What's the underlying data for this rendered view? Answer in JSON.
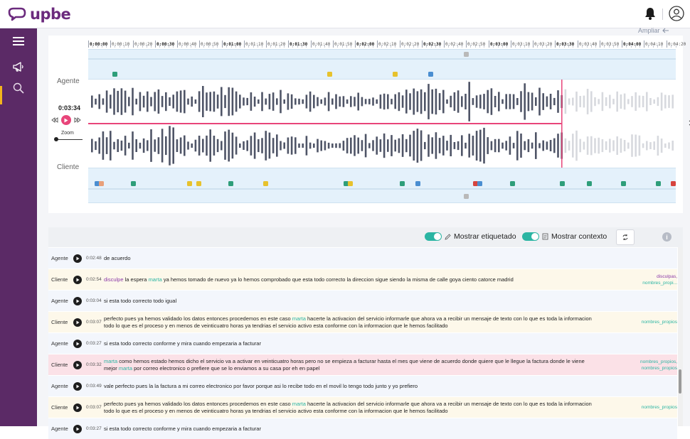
{
  "app": {
    "brand": "upbe"
  },
  "header": {
    "bell_icon": "bell-icon",
    "user_icon": "user-circle-icon"
  },
  "sidebar": {
    "items": [
      {
        "icon": "hamburger-menu-icon"
      },
      {
        "icon": "megaphone-icon",
        "active": true
      },
      {
        "icon": "search-icon"
      }
    ]
  },
  "waveform": {
    "ampliar": "Ampliar",
    "agent_label": "Agente",
    "client_label": "Cliente",
    "current_time": "0:03:34",
    "zoom_label": "Zoom",
    "playhead_fraction": 0.806,
    "ruler": [
      "0:00:00",
      "0:00:10",
      "0:00:20",
      "0:00:30",
      "0:00:40",
      "0:00:50",
      "0:01:00",
      "0:01:10",
      "0:01:20",
      "0:01:30",
      "0:01:40",
      "0:01:50",
      "0:02:00",
      "0:02:10",
      "0:02:20",
      "0:02:30",
      "0:02:40",
      "0:02:50",
      "0:03:00",
      "0:03:10",
      "0:03:20",
      "0:03:30",
      "0:03:40",
      "0:03:50",
      "0:04:00",
      "0:04:10",
      "0:04:20"
    ],
    "ruler_bold": [
      "0:00:00",
      "0:00:30",
      "0:01:00",
      "0:01:30",
      "0:02:00",
      "0:02:30",
      "0:03:00",
      "0:03:30",
      "0:04:00"
    ],
    "agent_top_markers": [
      {
        "pos": 0.643,
        "color": "#b9b9b9"
      }
    ],
    "agent_markers": [
      {
        "pos": 0.045,
        "color": "#2e9e7a"
      },
      {
        "pos": 0.41,
        "color": "#e7c22d"
      },
      {
        "pos": 0.522,
        "color": "#e7c22d"
      },
      {
        "pos": 0.582,
        "color": "#4a8ed1"
      }
    ],
    "client_markers": [
      {
        "pos": 0.015,
        "color": "#4a8ed1"
      },
      {
        "pos": 0.022,
        "color": "#e8a07a"
      },
      {
        "pos": 0.076,
        "color": "#2e9e7a"
      },
      {
        "pos": 0.172,
        "color": "#e7c22d"
      },
      {
        "pos": 0.188,
        "color": "#e7c22d"
      },
      {
        "pos": 0.242,
        "color": "#2e9e7a"
      },
      {
        "pos": 0.302,
        "color": "#e7c22d"
      },
      {
        "pos": 0.438,
        "color": "#2e9e7a"
      },
      {
        "pos": 0.446,
        "color": "#e7c22d"
      },
      {
        "pos": 0.534,
        "color": "#2e9e7a"
      },
      {
        "pos": 0.56,
        "color": "#4a8ed1"
      },
      {
        "pos": 0.658,
        "color": "#d6443e"
      },
      {
        "pos": 0.666,
        "color": "#4a8ed1"
      },
      {
        "pos": 0.722,
        "color": "#2e9e7a"
      },
      {
        "pos": 0.806,
        "color": "#2e9e7a"
      },
      {
        "pos": 0.852,
        "color": "#2e9e7a"
      },
      {
        "pos": 0.91,
        "color": "#2e9e7a"
      },
      {
        "pos": 0.97,
        "color": "#2e9e7a"
      },
      {
        "pos": 0.995,
        "color": "#d6443e"
      }
    ],
    "client_bottom_markers": [
      {
        "pos": 0.643,
        "color": "#b9b9b9"
      }
    ]
  },
  "transcript": {
    "toggle_tags": "Mostrar etiquetado",
    "toggle_context": "Mostrar contexto",
    "sync_icon": "sync-icon",
    "info": "i",
    "rows": [
      {
        "speaker": "Agente",
        "time": "0:02:48",
        "bg": "#f3f6fc",
        "segments": [
          {
            "t": "de acuerdo",
            "c": ""
          }
        ],
        "tags": []
      },
      {
        "speaker": "Cliente",
        "time": "0:02:54",
        "bg": "#fdf8ea",
        "segments": [
          {
            "t": "disculpe",
            "c": "hp"
          },
          {
            "t": " la espera ",
            "c": ""
          },
          {
            "t": "marta",
            "c": "hl"
          },
          {
            "t": " ya hemos tomado de nuevo ya lo hemos comprobado que esta todo correcto la direccion sigue siendo la misma de calle goya ciento catorce madrid",
            "c": ""
          }
        ],
        "tags": [
          {
            "t": "disculpas,",
            "c": "tgp"
          },
          {
            "t": "nombres_propi...",
            "c": "tgg"
          }
        ]
      },
      {
        "speaker": "Agente",
        "time": "0:03:04",
        "bg": "#f3f6fc",
        "segments": [
          {
            "t": "si esta todo correcto todo igual",
            "c": ""
          }
        ],
        "tags": []
      },
      {
        "speaker": "Cliente",
        "time": "0:03:07",
        "bg": "#fdf8ea",
        "segments": [
          {
            "t": "perfecto pues ya hemos validado los datos entonces procedemos en este caso ",
            "c": ""
          },
          {
            "t": "marta",
            "c": "hl"
          },
          {
            "t": " hacerte la activacion del servicio informarle que ahora va a recibir un mensaje de texto con lo que es toda la informacion todo lo que es el proceso y en menos de veinticuatro horas ya tendrias el servicio activo esta conforme con la informacion que le hemos facilitado",
            "c": ""
          }
        ],
        "tags": [
          {
            "t": "nombres_propios",
            "c": "tgg"
          }
        ]
      },
      {
        "speaker": "Agente",
        "time": "0:03:27",
        "bg": "#f3f6fc",
        "segments": [
          {
            "t": "si esta todo correcto conforme y mira cuando empezaria a facturar",
            "c": ""
          }
        ],
        "tags": []
      },
      {
        "speaker": "Cliente",
        "time": "0:03:32",
        "bg": "#fbe1e7",
        "segments": [
          {
            "t": "marta",
            "c": "hl"
          },
          {
            "t": " como hemos estado hemos dicho el servicio va a activar en veinticuatro horas pero no se empieza a facturar hasta el mes que viene de acuerdo donde quiere que le llegue la factura donde le viene mejor ",
            "c": ""
          },
          {
            "t": "marta",
            "c": "hl"
          },
          {
            "t": " por correo electronico o prefiere que se lo enviamos a su casa por eh en papel",
            "c": ""
          }
        ],
        "tags": [
          {
            "t": "nombres_propios,",
            "c": "tgg"
          },
          {
            "t": "nombres_propios",
            "c": "tgg"
          }
        ]
      },
      {
        "speaker": "Agente",
        "time": "0:03:49",
        "bg": "#f3f6fc",
        "segments": [
          {
            "t": "vale perfecto pues la la factura a mi correo electronico por favor porque asi lo recibe todo en el movil lo tengo todo junto y yo prefiero",
            "c": ""
          }
        ],
        "tags": []
      },
      {
        "speaker": "Cliente",
        "time": "0:03:07",
        "bg": "#fdf8ea",
        "segments": [
          {
            "t": "perfecto pues ya hemos validado los datos entonces procedemos en este caso ",
            "c": ""
          },
          {
            "t": "marta",
            "c": "hl"
          },
          {
            "t": " hacerte la activacion del servicio informarle que ahora va a recibir un mensaje de texto con lo que es toda la informacion todo lo que es el proceso y en menos de veinticuatro horas ya tendrias el servicio activo esta conforme con la informacion que le hemos facilitado",
            "c": ""
          }
        ],
        "tags": [
          {
            "t": "nombres_propios",
            "c": "tgg"
          }
        ]
      },
      {
        "speaker": "Agente",
        "time": "0:03:27",
        "bg": "#f3f6fc",
        "segments": [
          {
            "t": "si esta todo correcto conforme y mira cuando empezaria a facturar",
            "c": ""
          }
        ],
        "tags": []
      }
    ]
  }
}
